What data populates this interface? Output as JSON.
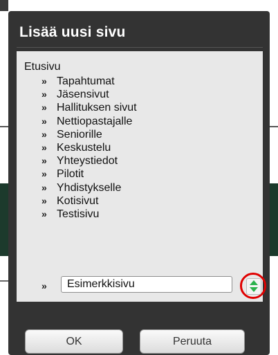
{
  "dialog": {
    "title": "Lisää uusi sivu",
    "root": "Etusivu",
    "bullet": "»",
    "pages": [
      "Tapahtumat",
      "Jäsensivut",
      "Hallituksen sivut",
      "Nettiopastajalle",
      "Seniorille",
      "Keskustelu",
      "Yhteystiedot",
      "Pilotit",
      "Yhdistykselle",
      "Kotisivut",
      "Testisivu"
    ],
    "new_page_value": "Esimerkkisivu",
    "ok_label": "OK",
    "cancel_label": "Peruuta"
  },
  "colors": {
    "dialog_bg": "#333333",
    "content_bg": "#e8e8e8",
    "highlight_circle": "#e00000",
    "spinner_arrows": "#2bb24c"
  },
  "icons": {
    "spinner": "up-down-spinner-icon"
  }
}
